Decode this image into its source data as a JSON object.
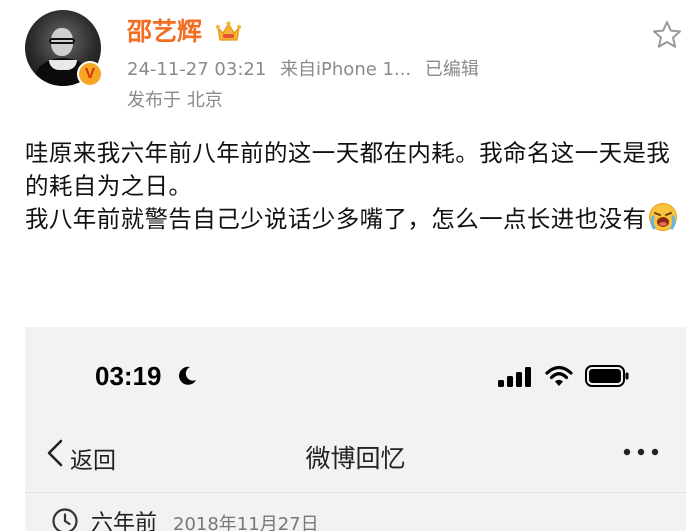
{
  "post": {
    "username": "邵艺辉",
    "crown_icon": "crown-icon",
    "verified_badge": "V",
    "timestamp": "24-11-27 03:21",
    "source": "来自iPhone 1...",
    "edited": "已编辑",
    "location": "发布于 北京",
    "star_icon": "star-outline-icon",
    "text_lines": [
      "哇原来我六年前八年前的这一天都在内耗。我命名这一天是我的耗自为之日。",
      "我八年前就警告自己少说话少多嘴了，怎么一点长进也没有"
    ],
    "emoji": "crying-face-emoji"
  },
  "screenshot": {
    "status_time": "03:19",
    "navbar": {
      "back_label": "返回",
      "title": "微博回忆"
    },
    "memory": {
      "label": "六年前",
      "date": "2018年11月27日"
    }
  },
  "colors": {
    "username": "#f26d22",
    "meta": "#8a8a8a",
    "badge_bg": "#f5a623",
    "badge_fg": "#d6300c"
  }
}
